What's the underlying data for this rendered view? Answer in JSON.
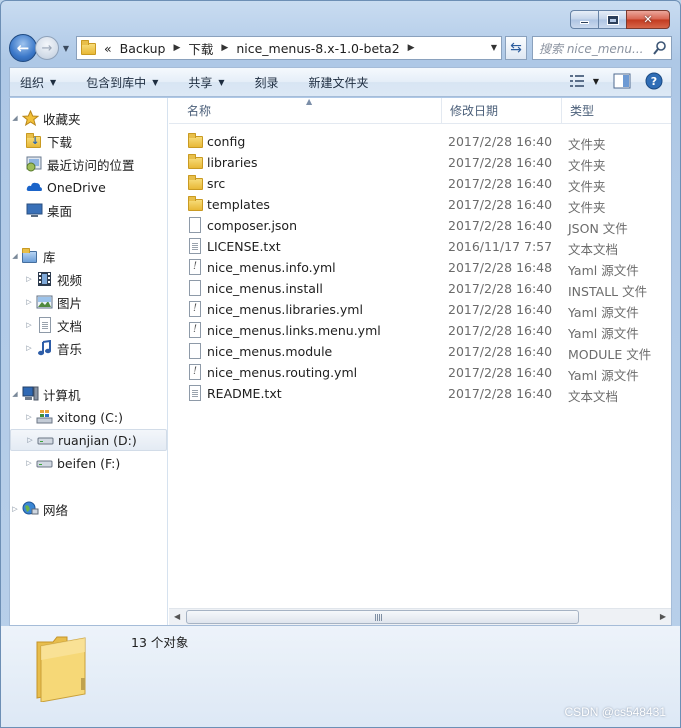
{
  "nav": {
    "crumbs": [
      "Backup",
      "下载",
      "nice_menus-8.x-1.0-beta2"
    ],
    "overflow": "«",
    "search_placeholder": "搜索 nice_menu..."
  },
  "toolbar": {
    "organize": "组织",
    "include_in_library": "包含到库中",
    "share": "共享",
    "burn": "刻录",
    "new_folder": "新建文件夹"
  },
  "sidebar": {
    "favorites": "收藏夹",
    "fav_items": [
      "下载",
      "最近访问的位置",
      "OneDrive",
      "桌面"
    ],
    "libraries": "库",
    "lib_items": [
      "视频",
      "图片",
      "文档",
      "音乐"
    ],
    "computer": "计算机",
    "drives": [
      "xitong (C:)",
      "ruanjian (D:)",
      "beifen (F:)"
    ],
    "network": "网络"
  },
  "columns": {
    "name": "名称",
    "date": "修改日期",
    "type": "类型"
  },
  "files": [
    {
      "name": "config",
      "date": "2017/2/28 16:40",
      "type": "文件夹",
      "icon": "folder-icon"
    },
    {
      "name": "libraries",
      "date": "2017/2/28 16:40",
      "type": "文件夹",
      "icon": "folder-icon"
    },
    {
      "name": "src",
      "date": "2017/2/28 16:40",
      "type": "文件夹",
      "icon": "folder-icon"
    },
    {
      "name": "templates",
      "date": "2017/2/28 16:40",
      "type": "文件夹",
      "icon": "folder-icon"
    },
    {
      "name": "composer.json",
      "date": "2017/2/28 16:40",
      "type": "JSON 文件",
      "icon": "document-icon"
    },
    {
      "name": "LICENSE.txt",
      "date": "2016/11/17 7:57",
      "type": "文本文档",
      "icon": "text-document-icon"
    },
    {
      "name": "nice_menus.info.yml",
      "date": "2017/2/28 16:48",
      "type": "Yaml 源文件",
      "icon": "yaml-file-icon"
    },
    {
      "name": "nice_menus.install",
      "date": "2017/2/28 16:40",
      "type": "INSTALL 文件",
      "icon": "document-icon"
    },
    {
      "name": "nice_menus.libraries.yml",
      "date": "2017/2/28 16:40",
      "type": "Yaml 源文件",
      "icon": "yaml-file-icon"
    },
    {
      "name": "nice_menus.links.menu.yml",
      "date": "2017/2/28 16:40",
      "type": "Yaml 源文件",
      "icon": "yaml-file-icon"
    },
    {
      "name": "nice_menus.module",
      "date": "2017/2/28 16:40",
      "type": "MODULE 文件",
      "icon": "document-icon"
    },
    {
      "name": "nice_menus.routing.yml",
      "date": "2017/2/28 16:40",
      "type": "Yaml 源文件",
      "icon": "yaml-file-icon"
    },
    {
      "name": "README.txt",
      "date": "2017/2/28 16:40",
      "type": "文本文档",
      "icon": "text-document-icon"
    }
  ],
  "details": {
    "count": "13 个对象"
  },
  "watermark": "CSDN @cs548431"
}
